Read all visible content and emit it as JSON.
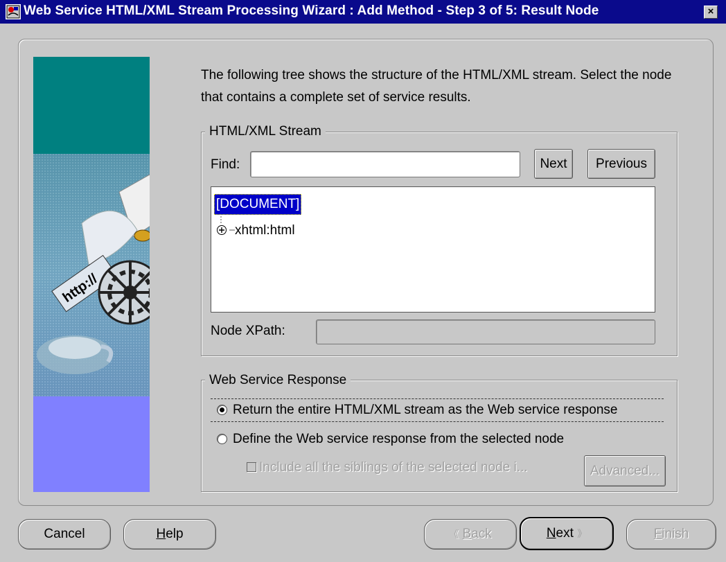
{
  "window": {
    "title": "Web Service HTML/XML Stream Processing Wizard : Add Method - Step 3 of 5: Result Node",
    "close_label": "×"
  },
  "intro": {
    "text": "The following tree shows the structure of the HTML/XML stream. Select the node that contains a complete set of service results."
  },
  "stream_group": {
    "legend": "HTML/XML Stream",
    "find_label": "Find:",
    "find_value": "",
    "next_button": "Next",
    "previous_button": "Previous",
    "tree": {
      "root": "[DOCUMENT]",
      "child": "xhtml:html",
      "child_expander": "⊕"
    },
    "xpath_label": "Node XPath:",
    "xpath_value": ""
  },
  "response_group": {
    "legend": "Web Service Response",
    "options": [
      {
        "label": "Return the entire HTML/XML stream as the Web service response",
        "selected": true
      },
      {
        "label": "Define the Web service response from the selected node",
        "selected": false
      }
    ],
    "siblings_checkbox": "Include all the siblings of the selected node i...",
    "advanced_button": "Advanced..."
  },
  "footer": {
    "cancel": "Cancel",
    "help_mnemonic": "H",
    "help_rest": "elp",
    "back_arrow": "《",
    "back_mnemonic": "B",
    "back_rest": "ack",
    "next_mnemonic": "N",
    "next_rest": "ext",
    "next_arrow": "》",
    "finish_mnemonic": "F",
    "finish_rest": "inish"
  },
  "colors": {
    "titlebar": "#0a0a8c",
    "window_bg": "#c8c8c8",
    "selection": "#0000c8",
    "art_teal": "#008080",
    "art_violet": "#8080ff"
  }
}
